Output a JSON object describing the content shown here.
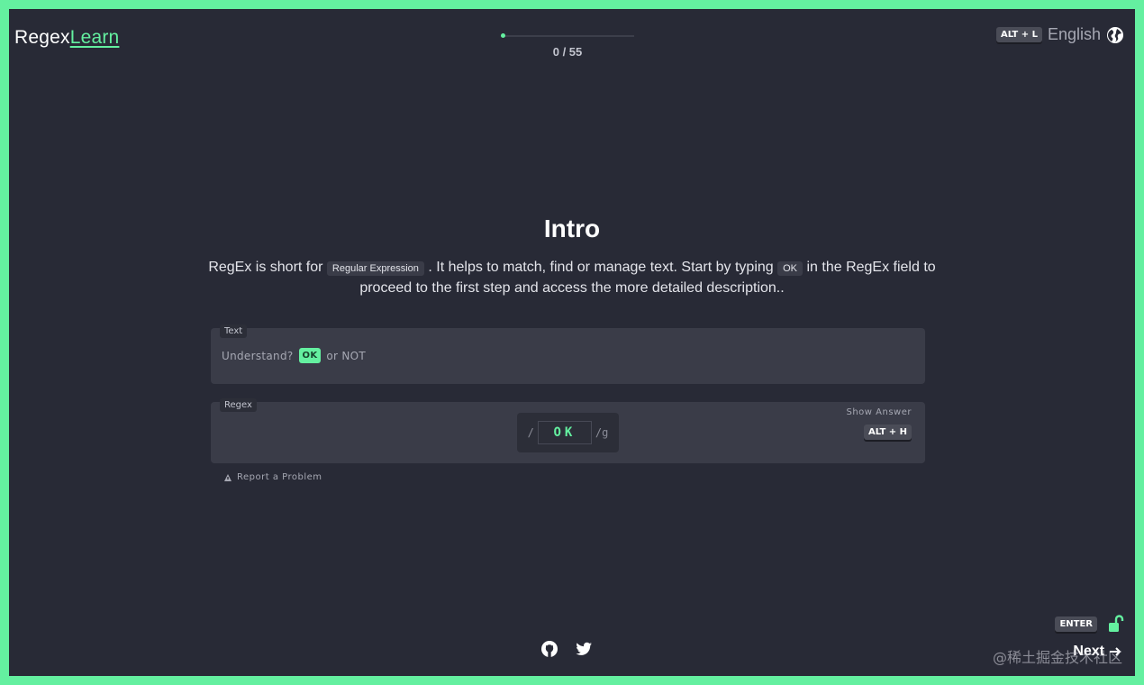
{
  "header": {
    "brand_main": "Regex",
    "brand_accent": "Learn",
    "progress_text": "0 / 55",
    "progress_value": 0,
    "progress_total": 55,
    "lang_shortcut": "ALT + L",
    "language": "English"
  },
  "lesson": {
    "title": "Intro",
    "desc_part1": "RegEx is short for ",
    "desc_code1": "Regular Expression",
    "desc_part2": " . It helps to match, find or manage text. Start by typing ",
    "desc_code2": "OK",
    "desc_part3": " in the RegEx field to proceed to the first step and access the more detailed description.."
  },
  "text_panel": {
    "label": "Text",
    "before": "Understand?",
    "match": "OK",
    "after": "or NOT"
  },
  "regex_panel": {
    "label": "Regex",
    "open_slash": "/",
    "value": "OK",
    "flags": "/g",
    "show_answer_label": "Show Answer",
    "show_answer_shortcut": "ALT + H"
  },
  "report": {
    "label": "Report a Problem"
  },
  "footer": {
    "enter_shortcut": "ENTER",
    "next_label": "Next",
    "watermark": "@稀土掘金技术社区"
  },
  "colors": {
    "accent": "#64f0a0",
    "background": "#282a36",
    "panel": "#3a3c48"
  },
  "icons": [
    "globe-icon",
    "bug-icon",
    "github-icon",
    "twitter-icon",
    "unlock-icon",
    "arrow-right-icon"
  ]
}
